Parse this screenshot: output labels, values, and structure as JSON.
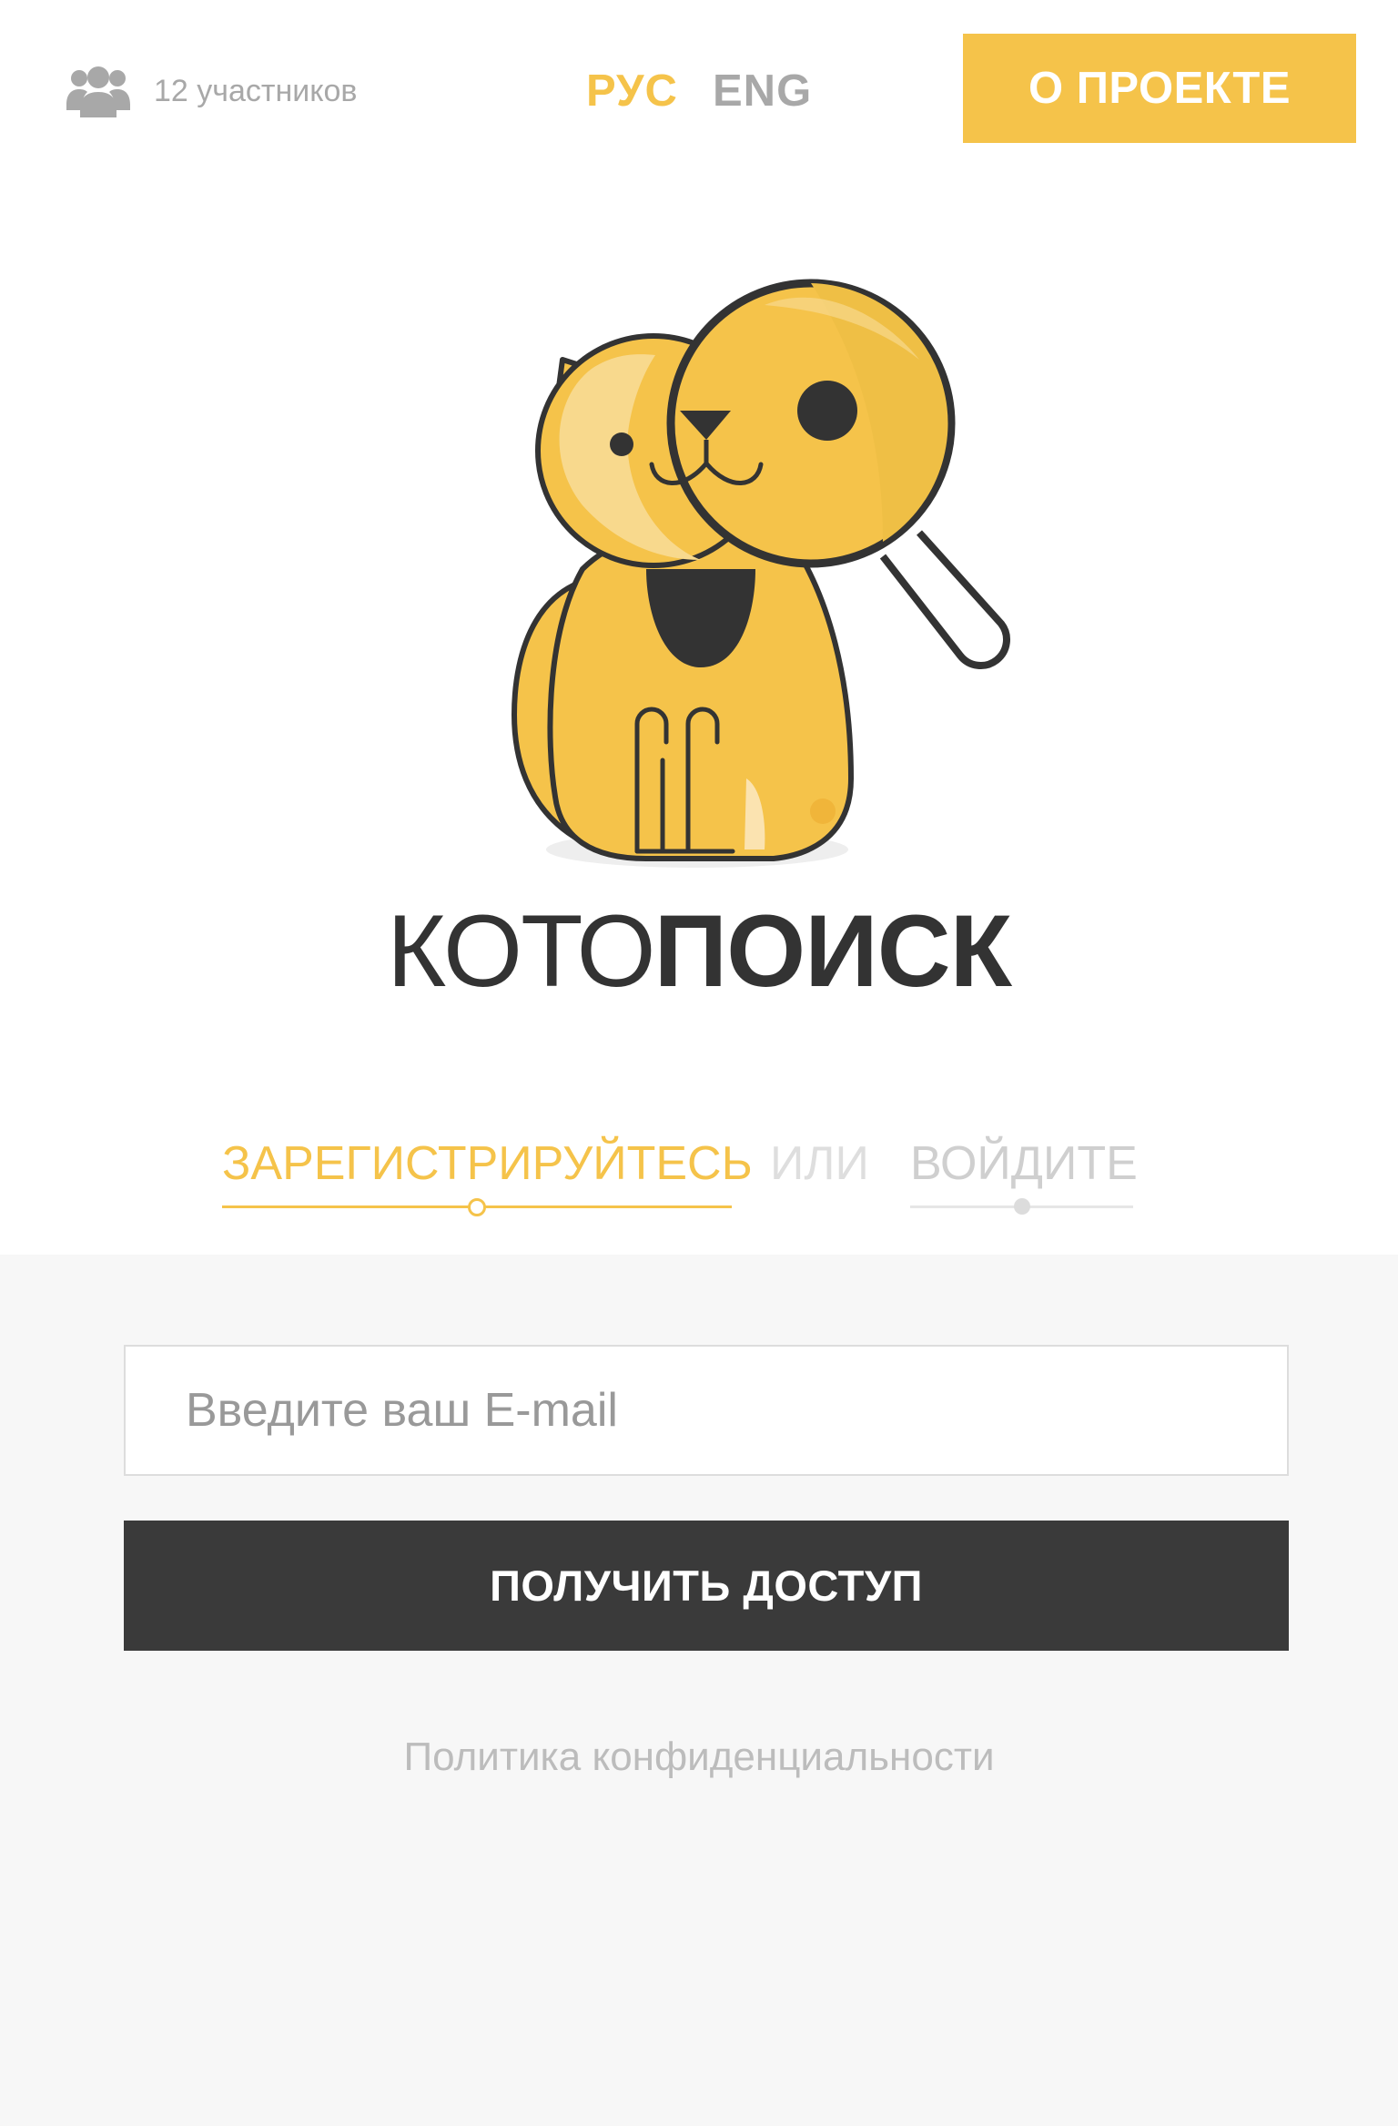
{
  "colors": {
    "accent": "#f5c34a",
    "dark": "#3a3a3a",
    "muted": "#a8a8a8",
    "text": "#333333"
  },
  "header": {
    "members_icon": "users-icon",
    "members_text": "12 участников",
    "languages": [
      {
        "label": "РУС",
        "active": true
      },
      {
        "label": "ENG",
        "active": false
      }
    ],
    "about_label": "О ПРОЕКТЕ"
  },
  "logo": {
    "icon": "cat-with-magnifier-logo",
    "brand_light": "КОТО",
    "brand_bold": "ПОИСК"
  },
  "auth": {
    "register_label": "ЗАРЕГИСТРИРУЙТЕСЬ",
    "or_label": "ИЛИ",
    "login_label": "ВОЙДИТЕ",
    "active_tab": "register"
  },
  "form": {
    "email_placeholder": "Введите ваш E-mail",
    "email_value": "",
    "submit_label": "ПОЛУЧИТЬ ДОСТУП",
    "privacy_label": "Политика конфиденциальности"
  }
}
